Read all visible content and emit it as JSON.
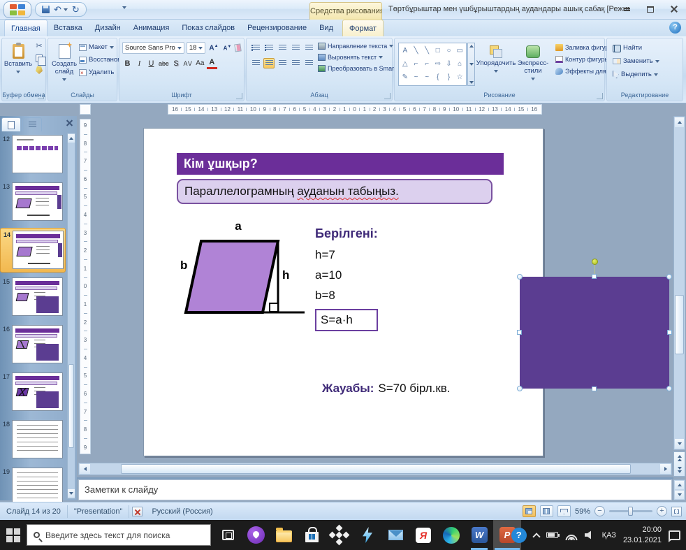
{
  "titlebar": {
    "contextual_tab_label": "Средства рисования",
    "title": "Төртбұрыштар мен үшбұрыштардың аудандары ашық сабақ [Режим совместимости] - Microsoft"
  },
  "ribbon_tabs": [
    {
      "id": "home",
      "label": "Главная",
      "active": true
    },
    {
      "id": "insert",
      "label": "Вставка"
    },
    {
      "id": "design",
      "label": "Дизайн"
    },
    {
      "id": "animation",
      "label": "Анимация"
    },
    {
      "id": "slideshow",
      "label": "Показ слайдов"
    },
    {
      "id": "review",
      "label": "Рецензирование"
    },
    {
      "id": "view",
      "label": "Вид"
    },
    {
      "id": "format",
      "label": "Формат",
      "contextual": true
    }
  ],
  "ribbon": {
    "clipboard": {
      "group_label": "Буфер обмена",
      "paste_label": "Вставить"
    },
    "slides": {
      "group_label": "Слайды",
      "new_slide_label": "Создать слайд",
      "layout_label": "Макет",
      "reset_label": "Восстановить",
      "delete_label": "Удалить"
    },
    "font": {
      "group_label": "Шрифт",
      "font_name": "Source Sans Pro",
      "font_size": "18",
      "format_buttons": [
        {
          "id": "bold",
          "label": "B"
        },
        {
          "id": "italic",
          "label": "I"
        },
        {
          "id": "underline",
          "label": "U"
        },
        {
          "id": "strikethrough",
          "label": "abc"
        },
        {
          "id": "shadow",
          "label": "S"
        },
        {
          "id": "char-spacing",
          "label": "AV"
        },
        {
          "id": "change-case",
          "label": "Aa"
        },
        {
          "id": "font-color",
          "label": "A"
        }
      ]
    },
    "paragraph": {
      "group_label": "Абзац",
      "text_direction_label": "Направление текста",
      "align_text_label": "Выровнять текст",
      "smartart_label": "Преобразовать в SmartArt"
    },
    "drawing": {
      "group_label": "Рисование",
      "arrange_label": "Упорядочить",
      "quick_styles_label": "Экспресс-стили",
      "shape_fill_label": "Заливка фигуры",
      "shape_outline_label": "Контур фигуры",
      "shape_effects_label": "Эффекты для фигур",
      "shape_gallery": [
        {
          "name": "text-box",
          "glyph": "A"
        },
        {
          "name": "line",
          "glyph": "╲"
        },
        {
          "name": "arrow-line",
          "glyph": "╲"
        },
        {
          "name": "rectangle",
          "glyph": "□"
        },
        {
          "name": "oval",
          "glyph": "○"
        },
        {
          "name": "rounded-rectangle",
          "glyph": "▭"
        },
        {
          "name": "triangle",
          "glyph": "△"
        },
        {
          "name": "elbow-connector",
          "glyph": "⌐"
        },
        {
          "name": "elbow-arrow-connector",
          "glyph": "⌐"
        },
        {
          "name": "right-arrow",
          "glyph": "⇨"
        },
        {
          "name": "down-arrow",
          "glyph": "⇩"
        },
        {
          "name": "pentagon",
          "glyph": "⌂"
        },
        {
          "name": "freeform",
          "glyph": "✎"
        },
        {
          "name": "curve",
          "glyph": "~"
        },
        {
          "name": "arc",
          "glyph": "~"
        },
        {
          "name": "left-brace",
          "glyph": "{"
        },
        {
          "name": "right-brace",
          "glyph": "}"
        },
        {
          "name": "star",
          "glyph": "☆"
        }
      ]
    },
    "editing": {
      "group_label": "Редактирование",
      "find_label": "Найти",
      "replace_label": "Заменить",
      "select_label": "Выделить"
    }
  },
  "rulers": {
    "horizontal": [
      "16",
      "15",
      "14",
      "13",
      "12",
      "11",
      "10",
      "9",
      "8",
      "7",
      "6",
      "5",
      "4",
      "3",
      "2",
      "1",
      "0",
      "1",
      "2",
      "3",
      "4",
      "5",
      "6",
      "7",
      "8",
      "9",
      "10",
      "11",
      "12",
      "13",
      "14",
      "15",
      "16"
    ],
    "vertical": [
      "9",
      "8",
      "7",
      "6",
      "5",
      "4",
      "3",
      "2",
      "1",
      "0",
      "1",
      "2",
      "3",
      "4",
      "5",
      "6",
      "7",
      "8",
      "9"
    ]
  },
  "slide_panel": {
    "slides": [
      {
        "number": "12",
        "variant": "bars"
      },
      {
        "number": "13",
        "variant": "full"
      },
      {
        "number": "14",
        "variant": "full",
        "selected": true
      },
      {
        "number": "15",
        "variant": "rect"
      },
      {
        "number": "16",
        "variant": "rectd"
      },
      {
        "number": "17",
        "variant": "rectx"
      },
      {
        "number": "18",
        "variant": "text"
      },
      {
        "number": "19",
        "variant": "text"
      }
    ]
  },
  "slide": {
    "title": "Кім ұшқыр?",
    "task_text": "Параллелограмның ",
    "task_text_underlined": "ауданын табыңыз.",
    "label_a": "a",
    "label_b": "b",
    "label_h": "h",
    "given_heading": "Берілгені:",
    "given_values": [
      "h=7",
      "a=10",
      "b=8"
    ],
    "formula": "S=a·h",
    "answer_label": "Жауабы:",
    "answer_text": "S=70 бірл.кв."
  },
  "notes": {
    "placeholder": "Заметки к слайду"
  },
  "statusbar": {
    "slide_counter": "Слайд 14 из 20",
    "theme_name": "\"Presentation\"",
    "language": "Русский (Россия)",
    "zoom_level": "59%"
  },
  "taskbar": {
    "search_placeholder": "Введите здесь текст для поиска",
    "apps": [
      {
        "name": "task-view"
      },
      {
        "name": "purple-drive"
      },
      {
        "name": "explorer"
      },
      {
        "name": "store"
      },
      {
        "name": "dropbox"
      },
      {
        "name": "lightning"
      },
      {
        "name": "mail"
      },
      {
        "name": "yandex",
        "glyph": "Я"
      },
      {
        "name": "edge"
      },
      {
        "name": "word",
        "glyph": "W",
        "running": true
      },
      {
        "name": "powerpoint",
        "glyph": "P",
        "running": true,
        "active": true
      }
    ],
    "language": "ҚАЗ",
    "time": "20:00",
    "date": "23.01.2021"
  },
  "glyphs": {
    "help": "?",
    "undo": "↶",
    "redo": "↻",
    "minus": "−",
    "plus": "+"
  },
  "colors": {
    "slide_accent_purple": "#6b2e99",
    "parallelogram_fill": "#b083d6",
    "selected_shape_fill": "#5b3d91",
    "task_box_fill": "#dcd0ee",
    "heading_text_purple": "#3f2a78"
  }
}
